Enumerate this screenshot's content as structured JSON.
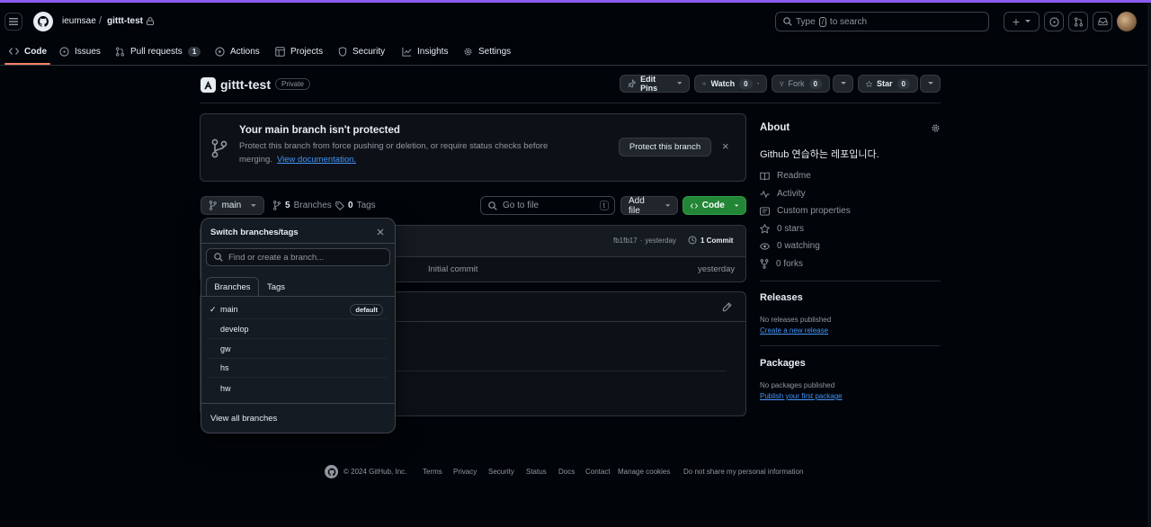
{
  "header": {
    "owner": "ieumsae",
    "separator": "/",
    "repo": "gittt-test",
    "search_placeholder_pre": "Type",
    "search_key": "/",
    "search_placeholder_post": "to search",
    "plus": "+"
  },
  "nav": {
    "tabs": [
      {
        "label": "Code"
      },
      {
        "label": "Issues"
      },
      {
        "label": "Pull requests",
        "count": "1"
      },
      {
        "label": "Actions"
      },
      {
        "label": "Projects"
      },
      {
        "label": "Security"
      },
      {
        "label": "Insights"
      },
      {
        "label": "Settings"
      }
    ]
  },
  "repo": {
    "title": "gittt-test",
    "visibility": "Private",
    "edit_pins": "Edit Pins",
    "watch": "Watch",
    "watch_count": "0",
    "fork": "Fork",
    "fork_count": "0",
    "star": "Star",
    "star_count": "0"
  },
  "banner": {
    "title": "Your main branch isn't protected",
    "text": "Protect this branch from force pushing or deletion, or require status checks before",
    "text2": "merging.",
    "link": "View documentation.",
    "button": "Protect this branch",
    "close": "×"
  },
  "toolbar": {
    "branch": "main",
    "branches_count": "5",
    "branches_label": "Branches",
    "tags_count": "0",
    "tags_label": "Tags",
    "goto_placeholder": "Go to file",
    "goto_key": "t",
    "add_file": "Add file",
    "code": "Code"
  },
  "commit": {
    "hash": "fb1fb17",
    "sep": "·",
    "time": "yesterday",
    "commits": "1 Commit",
    "file_message": "Initial commit",
    "file_time": "yesterday"
  },
  "dropdown": {
    "title": "Switch branches/tags",
    "placeholder": "Find or create a branch...",
    "tabs": [
      "Branches",
      "Tags"
    ],
    "branches": [
      {
        "name": "main",
        "checked": "✓",
        "badge": "default"
      },
      {
        "name": "develop"
      },
      {
        "name": "gw"
      },
      {
        "name": "hs"
      },
      {
        "name": "hw"
      }
    ],
    "view_all": "View all branches"
  },
  "about": {
    "title": "About",
    "description": "Github 연습하는 레포입니다.",
    "items": [
      "Readme",
      "Activity",
      "Custom properties",
      "0 stars",
      "0 watching",
      "0 forks"
    ]
  },
  "releases": {
    "title": "Releases",
    "text": "No releases published",
    "link": "Create a new release"
  },
  "packages": {
    "title": "Packages",
    "text": "No packages published",
    "link": "Publish your first package"
  },
  "footer": {
    "copyright": "© 2024 GitHub, Inc.",
    "links": [
      "Terms",
      "Privacy",
      "Security",
      "Status",
      "Docs",
      "Contact",
      "Manage cookies",
      "Do not share my personal information"
    ]
  },
  "colors": {
    "accent_underline": "#f78166",
    "green": "#238636",
    "link": "#4493f8"
  }
}
